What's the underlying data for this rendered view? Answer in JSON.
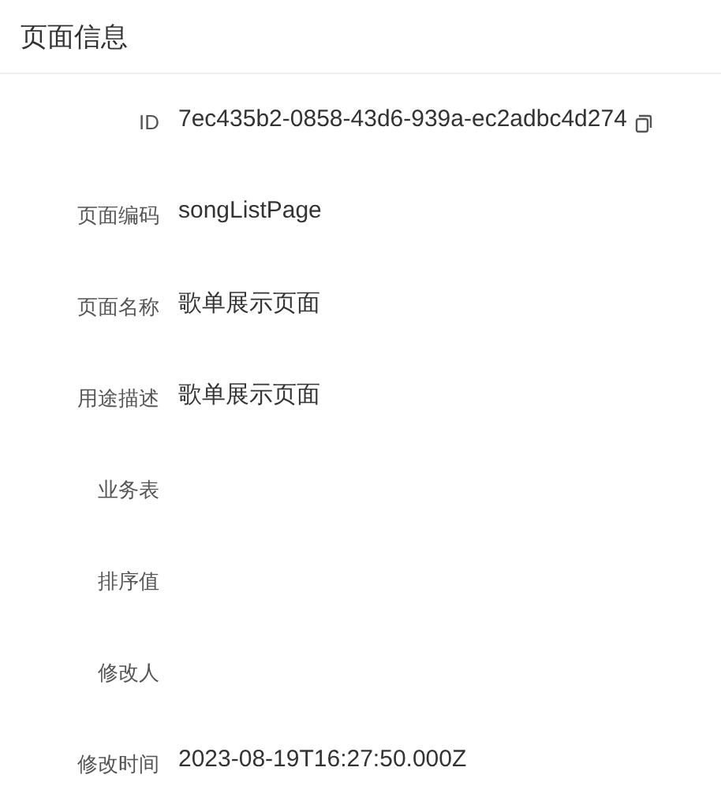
{
  "card": {
    "title": "页面信息"
  },
  "fields": [
    {
      "label": "ID",
      "value": "7ec435b2-0858-43d6-939a-ec2adbc4d274",
      "copyable": true
    },
    {
      "label": "页面编码",
      "value": "songListPage",
      "copyable": false
    },
    {
      "label": "页面名称",
      "value": "歌单展示页面",
      "copyable": false
    },
    {
      "label": "用途描述",
      "value": "歌单展示页面",
      "copyable": false
    },
    {
      "label": "业务表",
      "copyable": false
    },
    {
      "label": "排序值",
      "copyable": false
    },
    {
      "label": "修改人",
      "copyable": false
    },
    {
      "label": "修改时间",
      "value": "2023-08-19T16:27:50.000Z",
      "copyable": false
    }
  ]
}
